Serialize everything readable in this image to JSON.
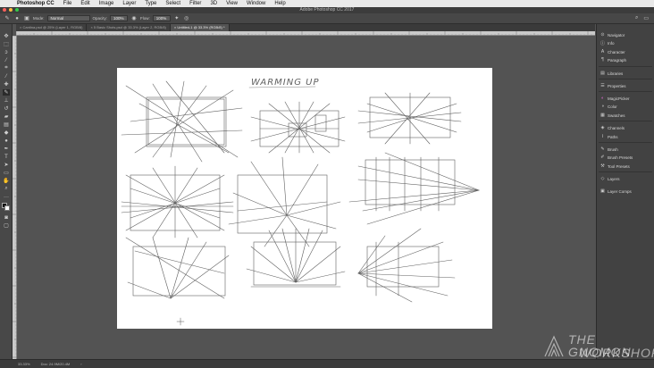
{
  "menubar": {
    "app_name": "Photoshop CC",
    "items": [
      "File",
      "Edit",
      "Image",
      "Layer",
      "Type",
      "Select",
      "Filter",
      "3D",
      "View",
      "Window",
      "Help"
    ]
  },
  "window": {
    "title": "Adobe Photoshop CC 2017"
  },
  "options_bar": {
    "mode_label": "Mode:",
    "mode_value": "Normal",
    "opacity_label": "Opacity:",
    "opacity_value": "100%",
    "flow_label": "Flow:",
    "flow_value": "100%"
  },
  "tabs": [
    {
      "label": "Cantina.psd @ 25% (Layer 1, RGB/8)",
      "active": false
    },
    {
      "label": "5 Basic Shots.psd @ 33.3% (Layer 2, RGB/8)",
      "active": false
    },
    {
      "label": "Untitled-1 @ 33.3% (RGB/8) *",
      "active": true
    }
  ],
  "canvas": {
    "heading": "WARMING UP"
  },
  "panels": [
    {
      "label": "Navigator",
      "icon": "navigator-icon"
    },
    {
      "label": "Info",
      "icon": "info-icon"
    },
    {
      "label": "Character",
      "icon": "character-icon"
    },
    {
      "label": "Paragraph",
      "icon": "paragraph-icon"
    },
    {
      "label": "Libraries",
      "icon": "libraries-icon"
    },
    {
      "label": "Properties",
      "icon": "properties-icon"
    },
    {
      "label": "Color",
      "icon": "color-icon"
    },
    {
      "label": "Swatches",
      "icon": "swatches-icon"
    },
    {
      "label": "Channels",
      "icon": "channels-icon"
    },
    {
      "label": "Paths",
      "icon": "paths-icon"
    },
    {
      "label": "Brush",
      "icon": "brush-icon"
    },
    {
      "label": "Brush Presets",
      "icon": "brush-presets-icon"
    },
    {
      "label": "Tool Presets",
      "icon": "tool-presets-icon"
    },
    {
      "label": "Layers",
      "icon": "layers-icon"
    },
    {
      "label": "Layer Comps",
      "icon": "layer-comps-icon"
    },
    {
      "label": "MagicPicker",
      "icon": "magicpicker-icon"
    }
  ],
  "status": {
    "zoom": "33.33%",
    "doc": "Doc: 24.9M/20.4M"
  },
  "watermark": {
    "line1": "THE GNOMON",
    "line2": "WORKSHOP"
  },
  "colors": {
    "accent": "#2d8ceb",
    "canvas_bg": "#535353",
    "panel_bg": "#424242"
  }
}
